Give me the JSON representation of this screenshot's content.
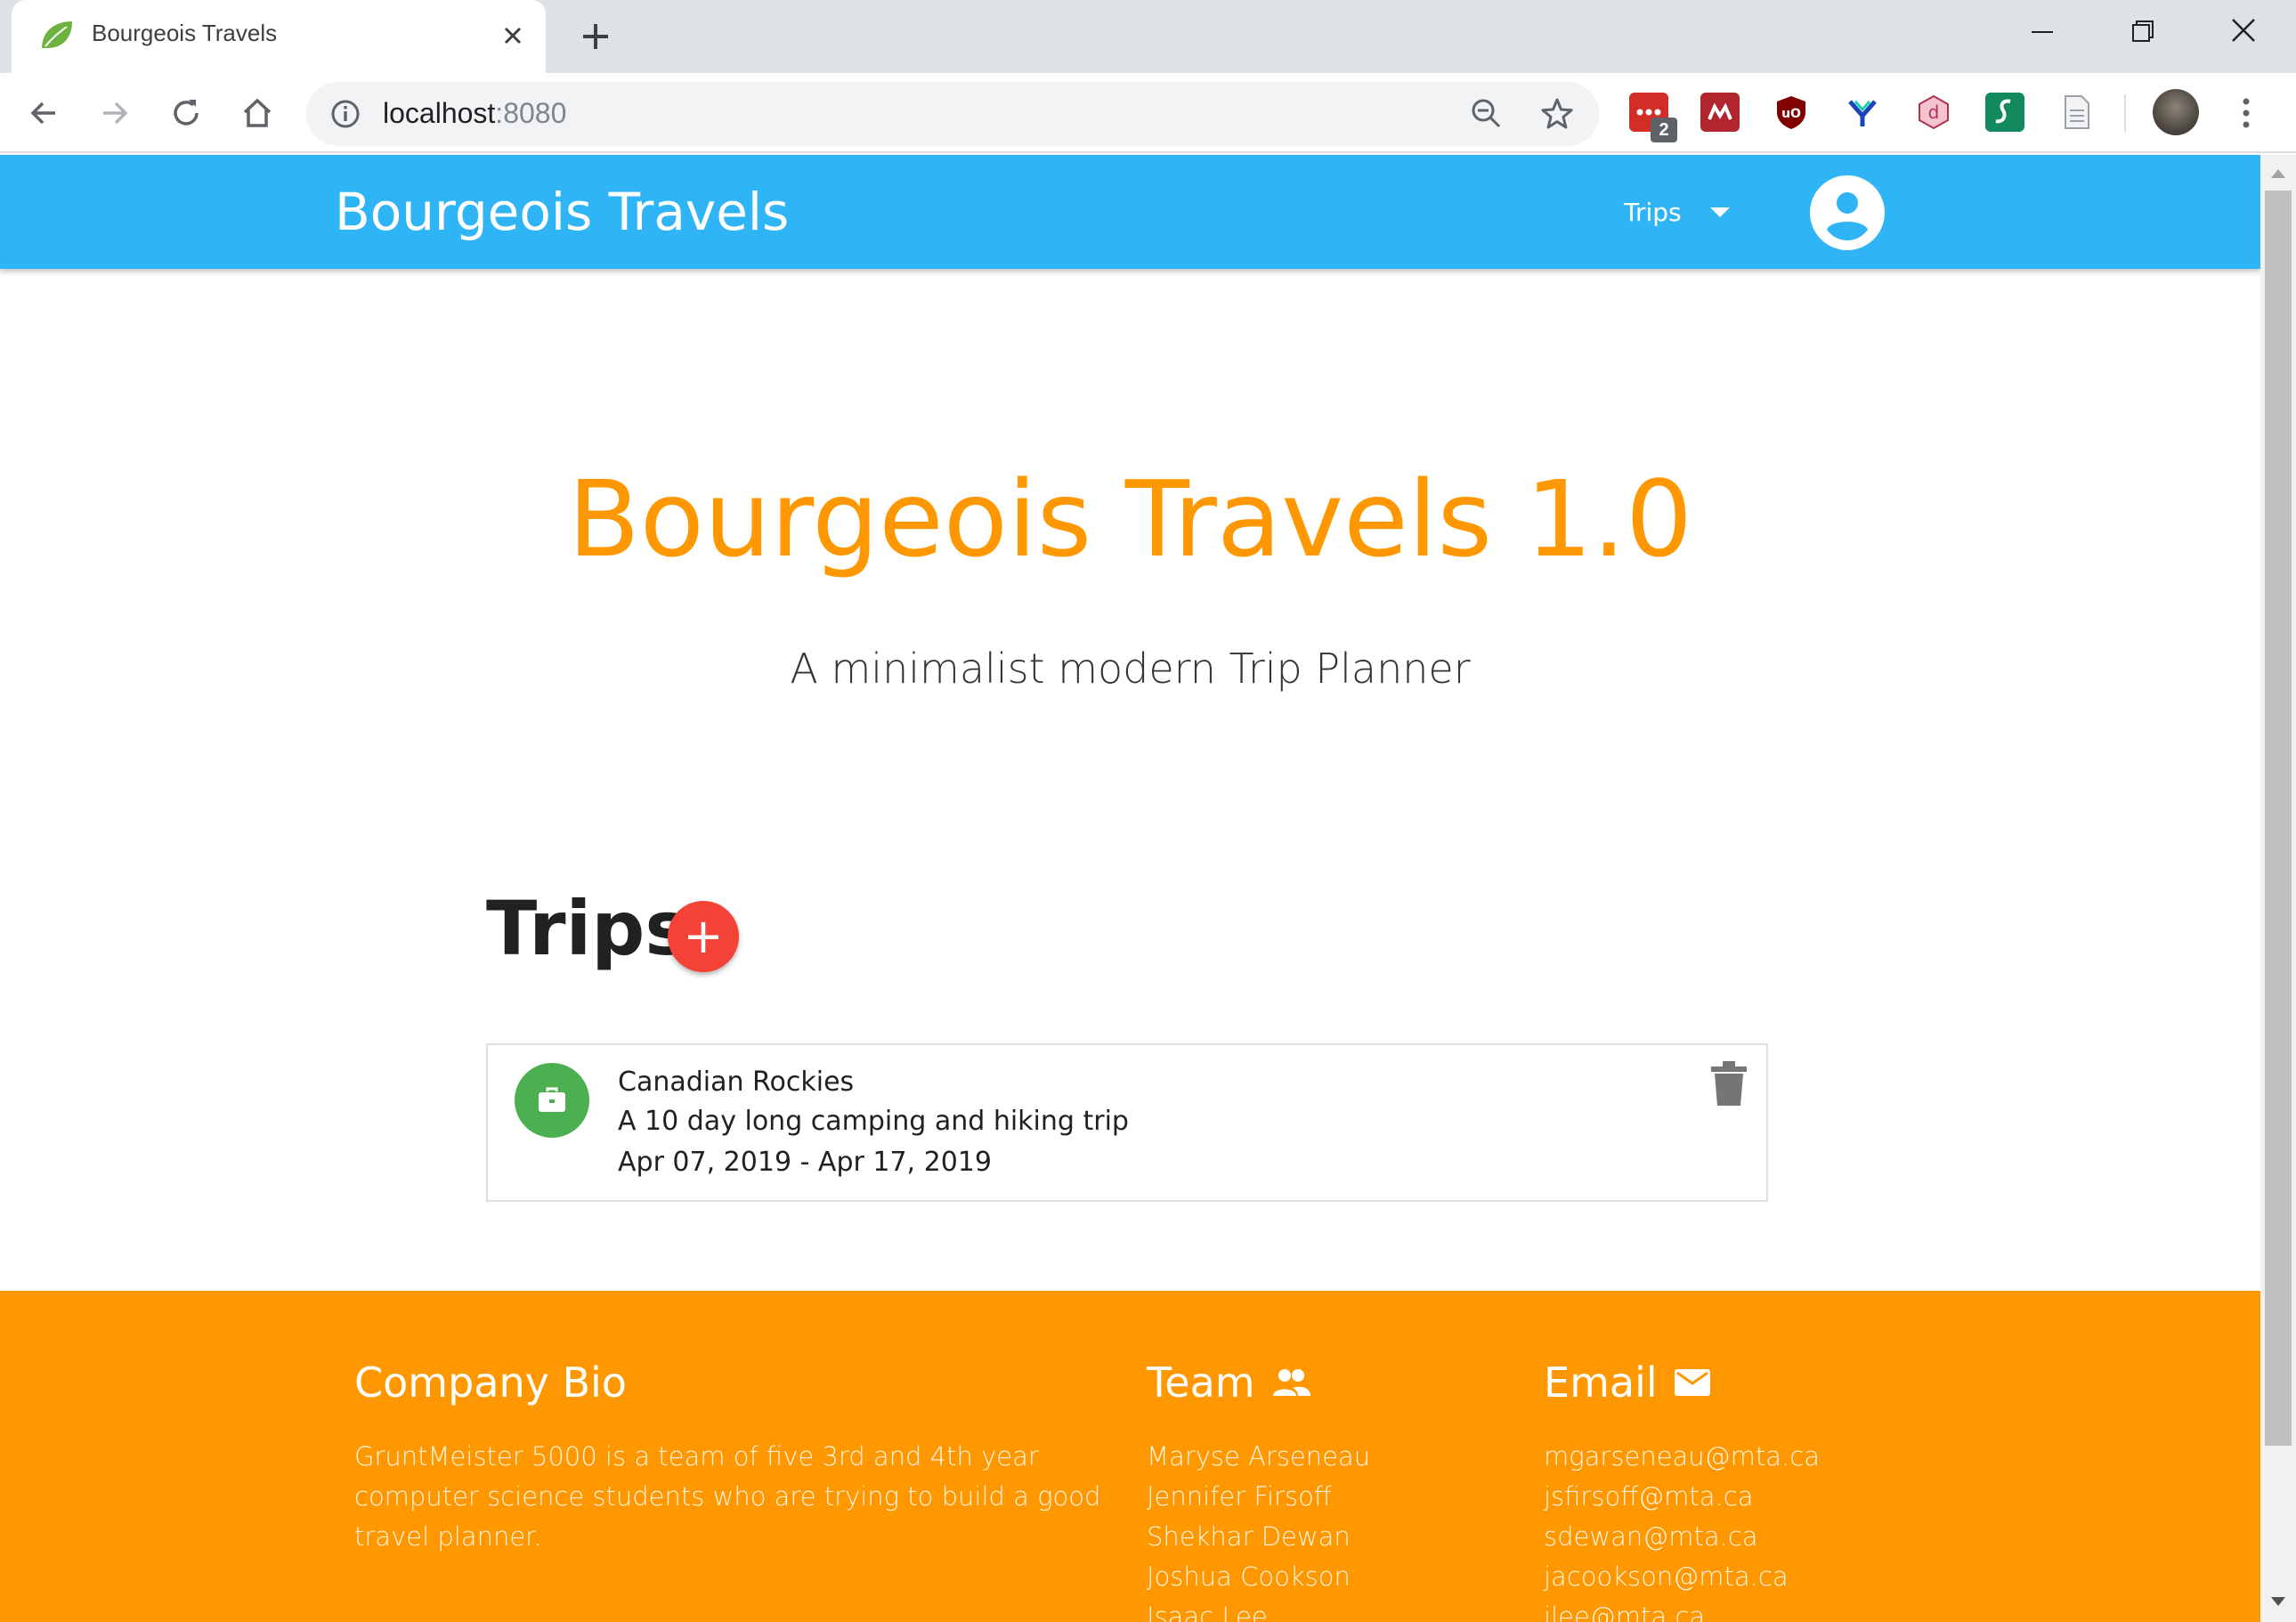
{
  "browser": {
    "tab_title": "Bourgeois Travels",
    "url_host": "localhost",
    "url_port": ":8080",
    "extension_badge": "2",
    "icons": [
      "leaf-favicon",
      "close-icon",
      "plus-icon",
      "back-icon",
      "forward-icon",
      "reload-icon",
      "home-icon",
      "info-icon",
      "zoom-out-icon",
      "star-icon",
      "lastpass-icon",
      "mendeley-icon",
      "ublock-icon",
      "yoroi-icon",
      "d-extension-icon",
      "script-extension-icon",
      "document-icon",
      "profile-avatar",
      "more-vert-icon"
    ]
  },
  "app": {
    "brand": "Bourgeois Travels",
    "nav_trips_label": "Trips",
    "accent_color": "#2fb5f5",
    "orange": "#ff9800"
  },
  "hero": {
    "title": "Bourgeois Travels 1.0",
    "subtitle": "A minimalist modern Trip Planner"
  },
  "trips": {
    "heading": "Trips",
    "add_button_label": "+",
    "items": [
      {
        "name": "Canadian Rockies",
        "description": "A 10 day long camping and hiking trip",
        "dates": "Apr 07, 2019 - Apr 17, 2019",
        "icon": "briefcase-icon"
      }
    ]
  },
  "footer": {
    "bio_title": "Company Bio",
    "bio_text": "GruntMeister 5000 is a team of five 3rd and 4th year computer science students who are trying to build a good travel planner.",
    "team_title": "Team",
    "team": [
      "Maryse Arseneau",
      "Jennifer Firsoff",
      "Shekhar Dewan",
      "Joshua Cookson",
      "Isaac Lee"
    ],
    "email_title": "Email",
    "emails": [
      "mgarseneau@mta.ca",
      "jsfirsoff@mta.ca",
      "sdewan@mta.ca",
      "jacookson@mta.ca",
      "ilee@mta.ca"
    ]
  }
}
